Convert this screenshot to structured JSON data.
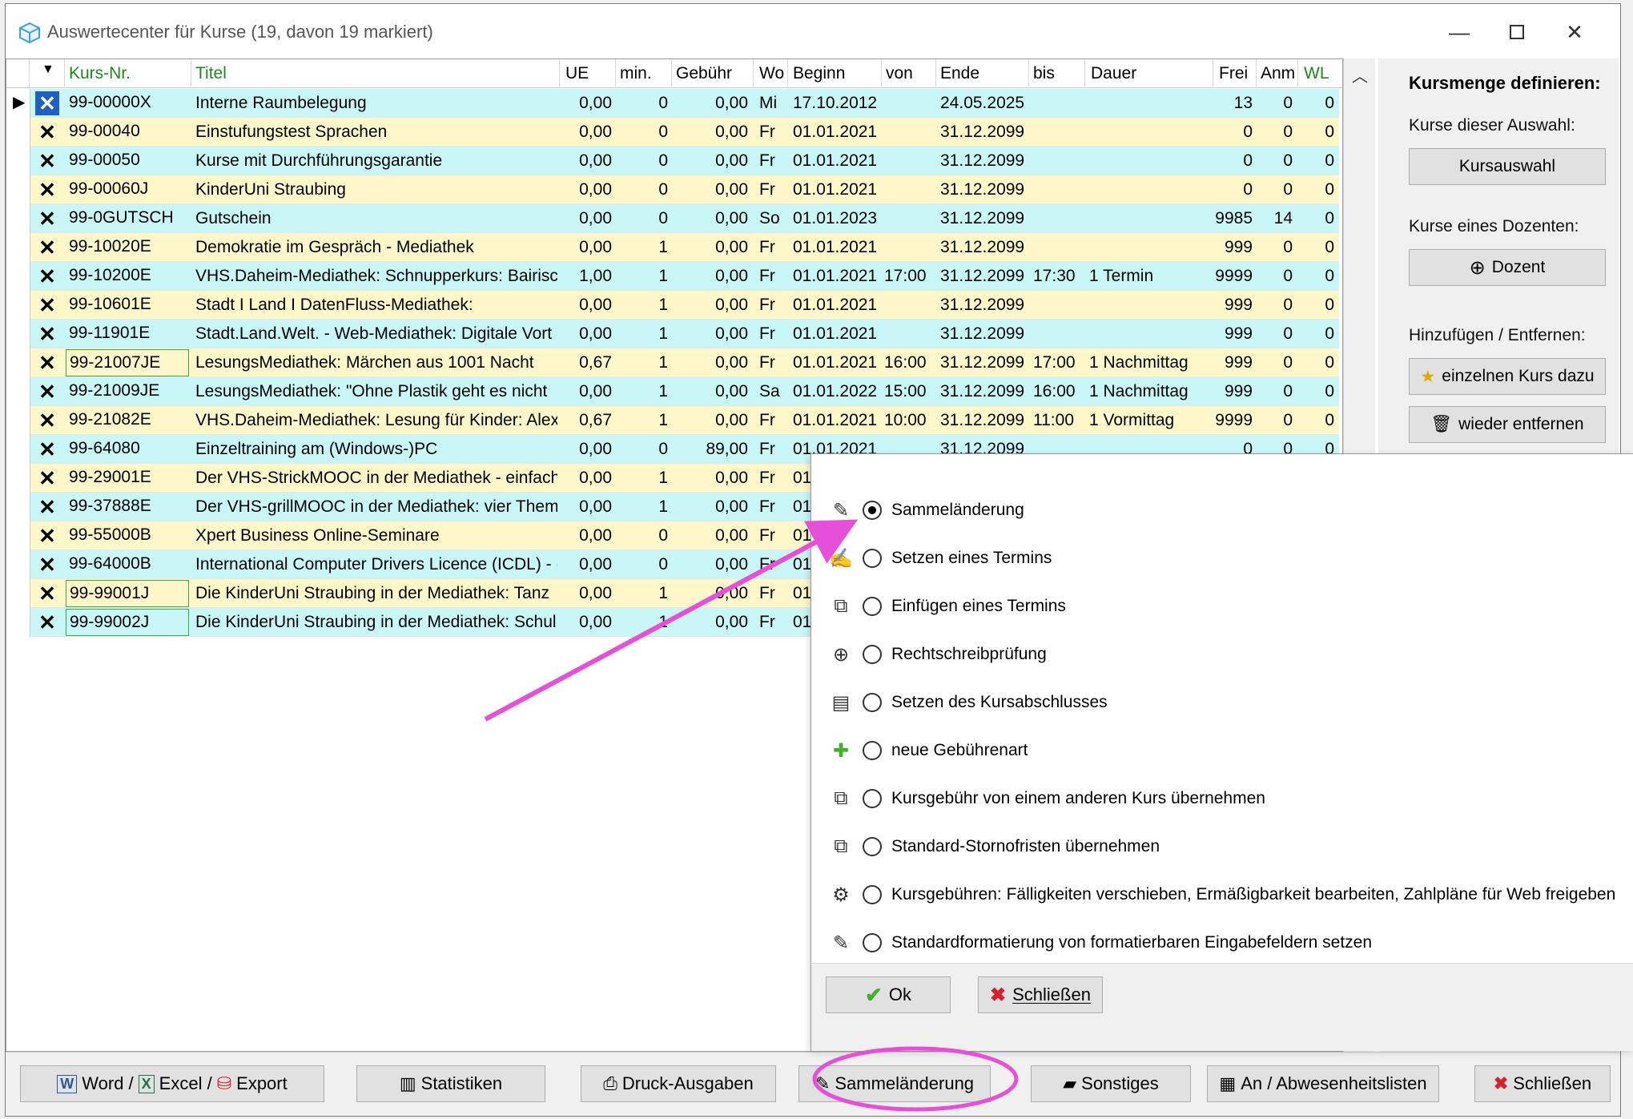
{
  "window": {
    "title": "Auswertecenter für Kurse (19, davon 19 markiert)"
  },
  "grid": {
    "columns": [
      {
        "label": "Kurs-Nr.",
        "green": true
      },
      {
        "label": "Titel",
        "green": true
      },
      {
        "label": "UE"
      },
      {
        "label": "min."
      },
      {
        "label": "Gebühr"
      },
      {
        "label": "Wo"
      },
      {
        "label": "Beginn"
      },
      {
        "label": "von"
      },
      {
        "label": "Ende"
      },
      {
        "label": "bis"
      },
      {
        "label": "Dauer"
      },
      {
        "label": "Frei"
      },
      {
        "label": "Anm"
      },
      {
        "label": "WL",
        "green": true
      }
    ],
    "rows": [
      {
        "kursnr": "99-00000X",
        "titel": "Interne Raumbelegung",
        "ue": "0,00",
        "min": "0",
        "gebuehr": "0,00",
        "wo": "Mi",
        "beginn": "17.10.2012",
        "von": "",
        "ende": "24.05.2025",
        "bis": "",
        "dauer": "",
        "frei": "13",
        "anm": "0",
        "wl": "0",
        "color": "cyan",
        "current": true,
        "boxed": false
      },
      {
        "kursnr": "99-00040",
        "titel": "Einstufungstest Sprachen",
        "ue": "0,00",
        "min": "0",
        "gebuehr": "0,00",
        "wo": "Fr",
        "beginn": "01.01.2021",
        "von": "",
        "ende": "31.12.2099",
        "bis": "",
        "dauer": "",
        "frei": "0",
        "anm": "0",
        "wl": "0",
        "color": "yellow",
        "current": false,
        "boxed": false
      },
      {
        "kursnr": "99-00050",
        "titel": "Kurse mit Durchführungsgarantie",
        "ue": "0,00",
        "min": "0",
        "gebuehr": "0,00",
        "wo": "Fr",
        "beginn": "01.01.2021",
        "von": "",
        "ende": "31.12.2099",
        "bis": "",
        "dauer": "",
        "frei": "0",
        "anm": "0",
        "wl": "0",
        "color": "cyan",
        "current": false,
        "boxed": false
      },
      {
        "kursnr": "99-00060J",
        "titel": "KinderUni Straubing",
        "ue": "0,00",
        "min": "0",
        "gebuehr": "0,00",
        "wo": "Fr",
        "beginn": "01.01.2021",
        "von": "",
        "ende": "31.12.2099",
        "bis": "",
        "dauer": "",
        "frei": "0",
        "anm": "0",
        "wl": "0",
        "color": "yellow",
        "current": false,
        "boxed": false
      },
      {
        "kursnr": "99-0GUTSCH",
        "titel": "Gutschein",
        "ue": "0,00",
        "min": "0",
        "gebuehr": "0,00",
        "wo": "So",
        "beginn": "01.01.2023",
        "von": "",
        "ende": "31.12.2099",
        "bis": "",
        "dauer": "",
        "frei": "9985",
        "anm": "14",
        "wl": "0",
        "color": "cyan",
        "current": false,
        "boxed": false
      },
      {
        "kursnr": "99-10020E",
        "titel": "Demokratie im Gespräch - Mediathek",
        "ue": "0,00",
        "min": "1",
        "gebuehr": "0,00",
        "wo": "Fr",
        "beginn": "01.01.2021",
        "von": "",
        "ende": "31.12.2099",
        "bis": "",
        "dauer": "",
        "frei": "999",
        "anm": "0",
        "wl": "0",
        "color": "yellow",
        "current": false,
        "boxed": false
      },
      {
        "kursnr": "99-10200E",
        "titel": "VHS.Daheim-Mediathek: Schnupperkurs: Bairisc",
        "ue": "1,00",
        "min": "1",
        "gebuehr": "0,00",
        "wo": "Fr",
        "beginn": "01.01.2021",
        "von": "17:00",
        "ende": "31.12.2099",
        "bis": "17:30",
        "dauer": "1 Termin",
        "frei": "9999",
        "anm": "0",
        "wl": "0",
        "color": "cyan",
        "current": false,
        "boxed": false
      },
      {
        "kursnr": "99-10601E",
        "titel": "Stadt I Land I DatenFluss-Mediathek:",
        "ue": "0,00",
        "min": "1",
        "gebuehr": "0,00",
        "wo": "Fr",
        "beginn": "01.01.2021",
        "von": "",
        "ende": "31.12.2099",
        "bis": "",
        "dauer": "",
        "frei": "999",
        "anm": "0",
        "wl": "0",
        "color": "yellow",
        "current": false,
        "boxed": false
      },
      {
        "kursnr": "99-11901E",
        "titel": "Stadt.Land.Welt. - Web-Mediathek: Digitale Vort",
        "ue": "0,00",
        "min": "1",
        "gebuehr": "0,00",
        "wo": "Fr",
        "beginn": "01.01.2021",
        "von": "",
        "ende": "31.12.2099",
        "bis": "",
        "dauer": "",
        "frei": "999",
        "anm": "0",
        "wl": "0",
        "color": "cyan",
        "current": false,
        "boxed": false
      },
      {
        "kursnr": "99-21007JE",
        "titel": "LesungsMediathek: Märchen aus 1001 Nacht",
        "ue": "0,67",
        "min": "1",
        "gebuehr": "0,00",
        "wo": "Fr",
        "beginn": "01.01.2021",
        "von": "16:00",
        "ende": "31.12.2099",
        "bis": "17:00",
        "dauer": "1 Nachmittag",
        "frei": "999",
        "anm": "0",
        "wl": "0",
        "color": "yellow",
        "current": false,
        "boxed": true
      },
      {
        "kursnr": "99-21009JE",
        "titel": "LesungsMediathek: \"Ohne Plastik geht es nicht",
        "ue": "0,00",
        "min": "1",
        "gebuehr": "0,00",
        "wo": "Sa",
        "beginn": "01.01.2022",
        "von": "15:00",
        "ende": "31.12.2099",
        "bis": "16:00",
        "dauer": "1 Nachmittag",
        "frei": "999",
        "anm": "0",
        "wl": "0",
        "color": "cyan",
        "current": false,
        "boxed": false
      },
      {
        "kursnr": "99-21082E",
        "titel": "VHS.Daheim-Mediathek: Lesung für Kinder: Alex",
        "ue": "0,67",
        "min": "1",
        "gebuehr": "0,00",
        "wo": "Fr",
        "beginn": "01.01.2021",
        "von": "10:00",
        "ende": "31.12.2099",
        "bis": "11:00",
        "dauer": "1 Vormittag",
        "frei": "9999",
        "anm": "0",
        "wl": "0",
        "color": "yellow",
        "current": false,
        "boxed": false
      },
      {
        "kursnr": "99-64080",
        "titel": "Einzeltraining am (Windows-)PC",
        "ue": "0,00",
        "min": "0",
        "gebuehr": "89,00",
        "wo": "Fr",
        "beginn": "01.01.2021",
        "von": "",
        "ende": "31.12.2099",
        "bis": "",
        "dauer": "",
        "frei": "0",
        "anm": "0",
        "wl": "0",
        "color": "cyan",
        "current": false,
        "boxed": false
      },
      {
        "kursnr": "99-29001E",
        "titel": "Der VHS-StrickMOOC in der Mediathek - einfach",
        "ue": "0,00",
        "min": "1",
        "gebuehr": "0,00",
        "wo": "Fr",
        "beginn": "01",
        "von": "",
        "ende": "",
        "bis": "",
        "dauer": "",
        "frei": "",
        "anm": "",
        "wl": "",
        "color": "yellow",
        "current": false,
        "boxed": false
      },
      {
        "kursnr": "99-37888E",
        "titel": "Der VHS-grillMOOC in der Mediathek: vier Them",
        "ue": "0,00",
        "min": "1",
        "gebuehr": "0,00",
        "wo": "Fr",
        "beginn": "01",
        "von": "",
        "ende": "",
        "bis": "",
        "dauer": "",
        "frei": "",
        "anm": "",
        "wl": "",
        "color": "cyan",
        "current": false,
        "boxed": false
      },
      {
        "kursnr": "99-55000B",
        "titel": "Xpert Business Online-Seminare",
        "ue": "0,00",
        "min": "0",
        "gebuehr": "0,00",
        "wo": "Fr",
        "beginn": "01",
        "von": "",
        "ende": "",
        "bis": "",
        "dauer": "",
        "frei": "",
        "anm": "",
        "wl": "",
        "color": "yellow",
        "current": false,
        "boxed": false
      },
      {
        "kursnr": "99-64000B",
        "titel": "International Computer Drivers Licence (ICDL) - (",
        "ue": "0,00",
        "min": "0",
        "gebuehr": "0,00",
        "wo": "Fr",
        "beginn": "01",
        "von": "",
        "ende": "",
        "bis": "",
        "dauer": "",
        "frei": "",
        "anm": "",
        "wl": "",
        "color": "cyan",
        "current": false,
        "boxed": false
      },
      {
        "kursnr": "99-99001J",
        "titel": "Die KinderUni Straubing in der Mediathek: Tanz",
        "ue": "0,00",
        "min": "1",
        "gebuehr": "0,00",
        "wo": "Fr",
        "beginn": "01",
        "von": "",
        "ende": "",
        "bis": "",
        "dauer": "",
        "frei": "",
        "anm": "",
        "wl": "",
        "color": "yellow",
        "current": false,
        "boxed": true
      },
      {
        "kursnr": "99-99002J",
        "titel": "Die KinderUni Straubing in der Mediathek: Schul",
        "ue": "0,00",
        "min": "1",
        "gebuehr": "0,00",
        "wo": "Fr",
        "beginn": "01",
        "von": "",
        "ende": "",
        "bis": "",
        "dauer": "",
        "frei": "",
        "anm": "",
        "wl": "",
        "color": "cyan",
        "current": false,
        "boxed": true
      }
    ]
  },
  "right_panel": {
    "heading": "Kursmenge definieren:",
    "label_selection": "Kurse dieser Auswahl:",
    "btn_kursauswahl": "Kursauswahl",
    "label_dozent": "Kurse eines Dozenten:",
    "btn_dozent": "Dozent",
    "label_add_remove": "Hinzufügen / Entfernen:",
    "btn_add": "einzelnen Kurs dazu",
    "btn_remove": "wieder entfernen"
  },
  "popup": {
    "options": [
      {
        "label": "Sammeländerung",
        "icon": "batch-edit-icon",
        "glyph": "✎",
        "checked": true
      },
      {
        "label": "Setzen eines Termins",
        "icon": "edit-document-icon",
        "glyph": "✍",
        "checked": false
      },
      {
        "label": "Einfügen eines Termins",
        "icon": "copy-icon",
        "glyph": "⧉",
        "checked": false
      },
      {
        "label": "Rechtschreibprüfung",
        "icon": "zoom-in-icon",
        "glyph": "⊕",
        "checked": false
      },
      {
        "label": "Setzen des Kursabschlusses",
        "icon": "document-icon",
        "glyph": "▤",
        "checked": false
      },
      {
        "label": "neue Gebührenart",
        "icon": "plus-icon",
        "glyph": "✚",
        "checked": false
      },
      {
        "label": "Kursgebühr von einem anderen Kurs übernehmen",
        "icon": "copy-icon",
        "glyph": "⧉",
        "checked": false
      },
      {
        "label": "Standard-Stornofristen übernehmen",
        "icon": "copy-icon",
        "glyph": "⧉",
        "checked": false
      },
      {
        "label": "Kursgebühren: Fälligkeiten verschieben, Ermäßigbarkeit bearbeiten, Zahlpläne für Web freigeben",
        "icon": "gear-icon",
        "glyph": "⚙",
        "checked": false
      },
      {
        "label": "Standardformatierung von formatierbaren Eingabefeldern setzen",
        "icon": "batch-edit-icon",
        "glyph": "✎",
        "checked": false
      }
    ],
    "ok_label": "Ok",
    "close_label": "Schließen"
  },
  "toolbar": {
    "word": "Word /",
    "excel": "Excel /",
    "export": "Export",
    "statistiken": "Statistiken",
    "druck": "Druck-Ausgaben",
    "sammel": "Sammeländerung",
    "sonstiges": "Sonstiges",
    "anwesenheit": "An / Abwesenheitslisten",
    "schliessen": "Schließen"
  },
  "colors": {
    "row_cyan": "#c9f6f6",
    "row_yellow": "#fdf7c9",
    "header_green": "#1a8a1a",
    "annotation_magenta": "#e64fd8",
    "close_red": "#d9202a",
    "ok_green": "#43b02a"
  }
}
